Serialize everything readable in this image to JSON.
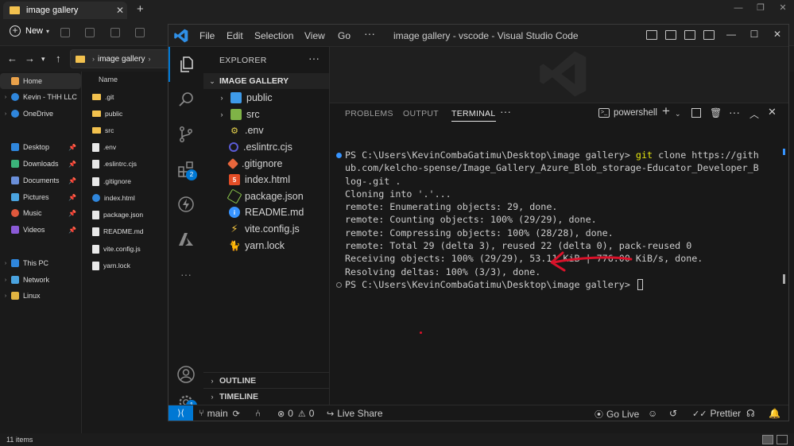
{
  "explorer_window": {
    "tab_title": "image gallery",
    "new_button": "New",
    "breadcrumb": "image gallery",
    "column_header": "Name",
    "nav_items": [
      {
        "label": "Home"
      },
      {
        "label": "Kevin - THH LLC"
      },
      {
        "label": "OneDrive"
      },
      {
        "label": "Desktop"
      },
      {
        "label": "Downloads"
      },
      {
        "label": "Documents"
      },
      {
        "label": "Pictures"
      },
      {
        "label": "Music"
      },
      {
        "label": "Videos"
      },
      {
        "label": "This PC"
      },
      {
        "label": "Network"
      },
      {
        "label": "Linux"
      }
    ],
    "files": [
      ".git",
      "public",
      "src",
      ".env",
      ".eslintrc.cjs",
      ".gitignore",
      "index.html",
      "package.json",
      "README.md",
      "vite.config.js",
      "yarn.lock"
    ],
    "status_text": "11 items"
  },
  "vscode": {
    "menu": [
      "File",
      "Edit",
      "Selection",
      "View",
      "Go"
    ],
    "window_title": "image gallery - vscode - Visual Studio Code",
    "activity_badges": {
      "extensions": "2",
      "settings": "1"
    },
    "explorer": {
      "title": "EXPLORER",
      "folder_name": "IMAGE GALLERY",
      "items": [
        {
          "label": "public",
          "kind": "folder",
          "icon_color": "#3e9ae8"
        },
        {
          "label": "src",
          "kind": "folder",
          "icon_color": "#7fb347"
        },
        {
          "label": ".env",
          "kind": "file",
          "icon_color": "#e8d44d"
        },
        {
          "label": ".eslintrc.cjs",
          "kind": "file",
          "icon_color": "#5b5bd6"
        },
        {
          "label": ".gitignore",
          "kind": "file",
          "icon_color": "#e8663c"
        },
        {
          "label": "index.html",
          "kind": "file",
          "icon_color": "#e44d26"
        },
        {
          "label": "package.json",
          "kind": "file",
          "icon_color": "#8cc84b"
        },
        {
          "label": "README.md",
          "kind": "file",
          "icon_color": "#3794ff"
        },
        {
          "label": "vite.config.js",
          "kind": "file",
          "icon_color": "#f7c843"
        },
        {
          "label": "yarn.lock",
          "kind": "file",
          "icon_color": "#2c8ebb"
        }
      ],
      "outline": "OUTLINE",
      "timeline": "TIMELINE"
    },
    "panel": {
      "tabs": [
        "PROBLEMS",
        "OUTPUT",
        "TERMINAL"
      ],
      "active_tab": "TERMINAL",
      "shell": "powershell",
      "terminal": {
        "prompt": "PS C:\\Users\\KevinCombaGatimu\\Desktop\\image gallery> ",
        "command": "git",
        "command_args_1": " clone https://gith",
        "wrap_2": "ub.com/kelcho-spense/Image_Gallery_Azure_Blob_storage-Educator_Developer_B",
        "wrap_3": "log-.git .",
        "output": [
          "Cloning into '.'...",
          "remote: Enumerating objects: 29, done.",
          "remote: Counting objects: 100% (29/29), done.",
          "remote: Compressing objects: 100% (28/28), done.",
          "remote: Total 29 (delta 3), reused 22 (delta 0), pack-reused 0",
          "Receiving objects: 100% (29/29), 53.11 KiB | 776.00 KiB/s, done.",
          "Resolving deltas: 100% (3/3), done."
        ],
        "final_prompt": "PS C:\\Users\\KevinCombaGatimu\\Desktop\\image gallery> "
      }
    },
    "status_bar": {
      "branch": "main",
      "errors": "0",
      "warnings": "0",
      "live_share": "Live Share",
      "go_live": "Go Live",
      "prettier": "Prettier"
    },
    "colors": {
      "accent": "#0078d4",
      "annotation_arrow": "#d9122a",
      "terminal_command": "#e5e510"
    }
  }
}
